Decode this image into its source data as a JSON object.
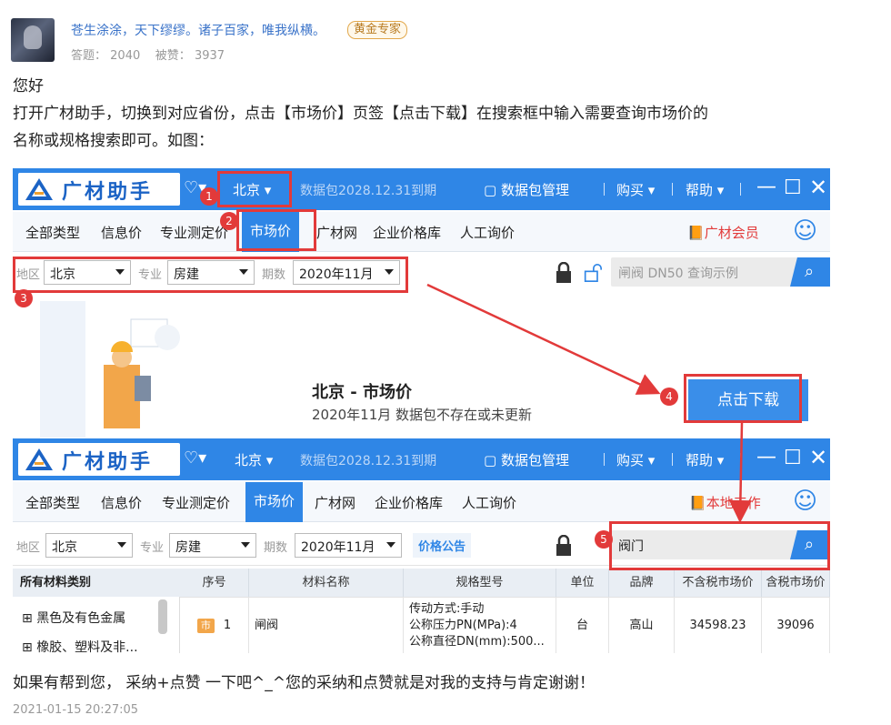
{
  "answer": {
    "user_name": "苍生涂涂，天下缪缪。诸子百家，唯我纵横。",
    "badge": "黄金专家",
    "stats_answers_label": "答题：",
    "stats_answers": "2040",
    "stats_likes_label": "被赞：",
    "stats_likes": "3937",
    "greeting": "您好",
    "body_line1": "打开广材助手，切换到对应省份，点击【市场价】页签【点击下载】在搜索框中输入需要查询市场价的",
    "body_line2": "名称或规格搜索即可。如图：",
    "footer": "如果有帮到您， 采纳+点赞 一下吧^_^您的采纳和点赞就是对我的支持与肯定谢谢！",
    "timestamp": "2021-01-15 20:27:05"
  },
  "app": {
    "logo_text": "广材助手",
    "city": "北京",
    "package_expiry": "数据包2028.12.31到期",
    "package_manage": "数据包管理",
    "buy": "购买",
    "help": "帮助",
    "nav": [
      "全部类型",
      "信息价",
      "专业测定价",
      "市场价",
      "广材网",
      "企业价格库",
      "人工询价"
    ],
    "member": "广材会员",
    "member2": "本地工作",
    "filter_region_label": "地区",
    "filter_region": "北京",
    "filter_major_label": "专业",
    "filter_major": "房建",
    "filter_period_label": "期数",
    "filter_period": "2020年11月",
    "price_notice": "价格公告",
    "search_placeholder": "闸阀 DN50 查询示例",
    "search_value": "阀门",
    "hero_title": "北京 - 市场价",
    "hero_sub": "2020年11月 数据包不存在或未更新",
    "download_btn": "点击下载",
    "sidebar_header": "所有材料类别",
    "sidebar_items": [
      "黑色及有色金属",
      "橡胶、塑料及非..."
    ],
    "columns": [
      "序号",
      "材料名称",
      "规格型号",
      "单位",
      "品牌",
      "不含税市场价",
      "含税市场价"
    ],
    "row": {
      "tag": "市",
      "index": "1",
      "name": "闸阀",
      "spec1": "传动方式:手动",
      "spec2": "公称压力PN(MPa):4",
      "spec3": "公称直径DN(mm):500...",
      "unit": "台",
      "brand": "高山",
      "price_ex": "34598.23",
      "price_in": "39096"
    },
    "markers": [
      "1",
      "2",
      "3",
      "4",
      "5"
    ],
    "colors": {
      "primary": "#2f86e6",
      "marker": "#e23a3a"
    }
  }
}
